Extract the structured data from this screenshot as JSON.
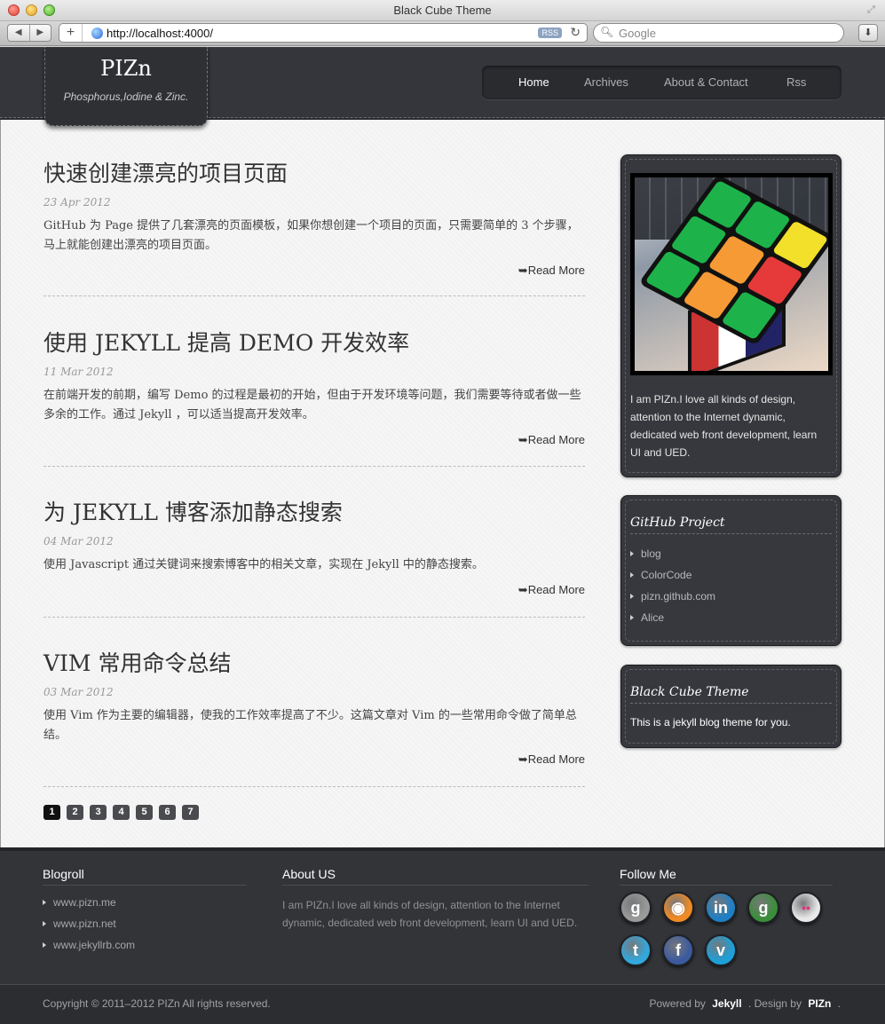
{
  "window": {
    "title": "Black Cube Theme",
    "url": "http://localhost:4000/",
    "rss_label": "RSS",
    "search_placeholder": "Google"
  },
  "site": {
    "title": "PIZn",
    "tagline": "Phosphorus,Iodine & Zinc."
  },
  "nav": [
    {
      "label": "Home",
      "active": true
    },
    {
      "label": "Archives",
      "active": false
    },
    {
      "label": "About & Contact",
      "active": false
    },
    {
      "label": "Rss",
      "active": false
    }
  ],
  "posts": [
    {
      "title": "快速创建漂亮的项目页面",
      "date": "23 Apr 2012",
      "excerpt": "GitHub 为 Page 提供了几套漂亮的页面模板，如果你想创建一个项目的页面，只需要简单的 3 个步骤，马上就能创建出漂亮的项目页面。",
      "read_more": "➥Read More"
    },
    {
      "title": "使用 JEKYLL 提高 DEMO 开发效率",
      "date": "11 Mar 2012",
      "excerpt": "在前端开发的前期，编写 Demo 的过程是最初的开始，但由于开发环境等问题，我们需要等待或者做一些多余的工作。通过 Jekyll ，可以适当提高开发效率。",
      "read_more": "➥Read More"
    },
    {
      "title": "为 JEKYLL 博客添加静态搜索",
      "date": "04 Mar 2012",
      "excerpt": "使用 Javascript 通过关键词来搜索博客中的相关文章，实现在 Jekyll 中的静态搜索。",
      "read_more": "➥Read More"
    },
    {
      "title": "VIM 常用命令总结",
      "date": "03 Mar 2012",
      "excerpt": "使用 Vim 作为主要的编辑器，使我的工作效率提高了不少。这篇文章对 Vim 的一些常用命令做了简单总结。",
      "read_more": "➥Read More"
    }
  ],
  "pagination": {
    "pages": [
      "1",
      "2",
      "3",
      "4",
      "5",
      "6",
      "7"
    ],
    "current": "1"
  },
  "sidebar": {
    "about": "I am PIZn.I love all kinds of design, attention to the Internet dynamic, dedicated web front development, learn UI and UED.",
    "github": {
      "title": "GitHub Project",
      "items": [
        "blog",
        "ColorCode",
        "pizn.github.com",
        "Alice"
      ]
    },
    "theme": {
      "title": "Black Cube Theme",
      "text": "This is a jekyll blog theme for you."
    }
  },
  "footer": {
    "blogroll": {
      "title": "Blogroll",
      "links": [
        "www.pizn.me",
        "www.pizn.net",
        "www.jekyllrb.com"
      ]
    },
    "about": {
      "title": "About US",
      "text": "I am PIZn.I love all kinds of design, attention to the Internet dynamic, dedicated web front development, learn UI and UED."
    },
    "follow": {
      "title": "Follow Me",
      "icons": [
        {
          "name": "google-icon",
          "glyph": "g",
          "color": "#9a9a9a"
        },
        {
          "name": "rss-icon",
          "glyph": "◉",
          "color": "#f08a24"
        },
        {
          "name": "linkedin-icon",
          "glyph": "in",
          "color": "#1f7fc4"
        },
        {
          "name": "google-plus-icon",
          "glyph": "g",
          "color": "#3b8e3b"
        },
        {
          "name": "flickr-icon",
          "glyph": "••",
          "color": "#e8e8e8"
        },
        {
          "name": "twitter-icon",
          "glyph": "t",
          "color": "#32a8dd"
        },
        {
          "name": "facebook-icon",
          "glyph": "f",
          "color": "#3b5a9e"
        },
        {
          "name": "vimeo-icon",
          "glyph": "v",
          "color": "#1ca0d8"
        }
      ]
    },
    "copyright": "Copyright © 2011–2012 PIZn All rights reserved.",
    "powered_by_label": "Powered by",
    "powered_by": "Jekyll",
    "design_by_label": ". Design by",
    "design_by": "PIZn",
    "end_mark": "."
  }
}
